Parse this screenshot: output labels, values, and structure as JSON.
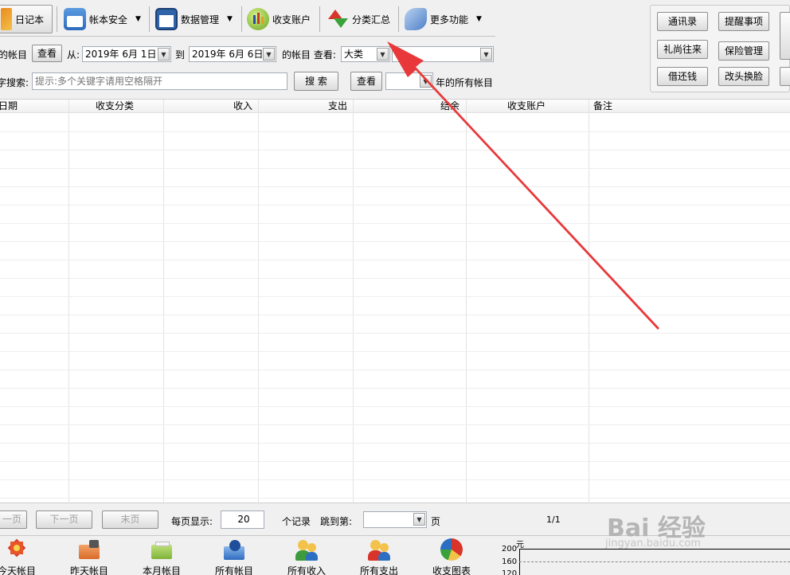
{
  "toolbar": {
    "diary": "日记本",
    "account_security": "帐本安全",
    "data_management": "数据管理",
    "income_expense_accounts": "收支账户",
    "category_summary": "分类汇总",
    "more_functions": "更多功能"
  },
  "filter": {
    "records_label": "的帐目",
    "view_button": "查看",
    "from_label": "从:",
    "from_date": "2019年 6月 1日",
    "to_label": "到",
    "to_date": "2019年 6月 6日",
    "records_view_label": "的帐目 查看:",
    "category_level": "大类",
    "category_value": ""
  },
  "search": {
    "label": "字搜索:",
    "placeholder": "提示:多个关键字请用空格隔开",
    "search_button": "搜 索",
    "view_button": "查看",
    "year_value": "",
    "year_suffix": "年的所有帐目"
  },
  "table": {
    "columns": [
      "日期",
      "收支分类",
      "收入",
      "支出",
      "结余",
      "收支账户",
      "备注"
    ]
  },
  "right_panel": {
    "contacts": "通讯录",
    "reminders": "提醒事项",
    "gifts": "礼尚往来",
    "insurance": "保险管理",
    "loans": "借还钱",
    "skin": "改头换脸"
  },
  "pagination": {
    "prev": "一页",
    "next": "下一页",
    "last": "末页",
    "per_page_label": "每页显示:",
    "per_page_value": "20",
    "records_label": "个记录",
    "jump_label": "跳到第:",
    "jump_value": "",
    "page_label": "页",
    "page_info": "1/1"
  },
  "quickbar": {
    "today": "今天帐目",
    "yesterday": "昨天帐目",
    "this_month": "本月帐目",
    "all": "所有帐目",
    "all_income": "所有收入",
    "all_expense": "所有支出",
    "chart": "收支图表"
  },
  "mini_chart": {
    "unit": "元",
    "ticks": [
      "200",
      "160",
      "120"
    ]
  },
  "watermark": {
    "logo": "Bai 经验",
    "url": "jingyan.baidu.com"
  },
  "colors": {
    "annotation_arrow": "#e8383a",
    "grid_line": "#eeeeee"
  }
}
